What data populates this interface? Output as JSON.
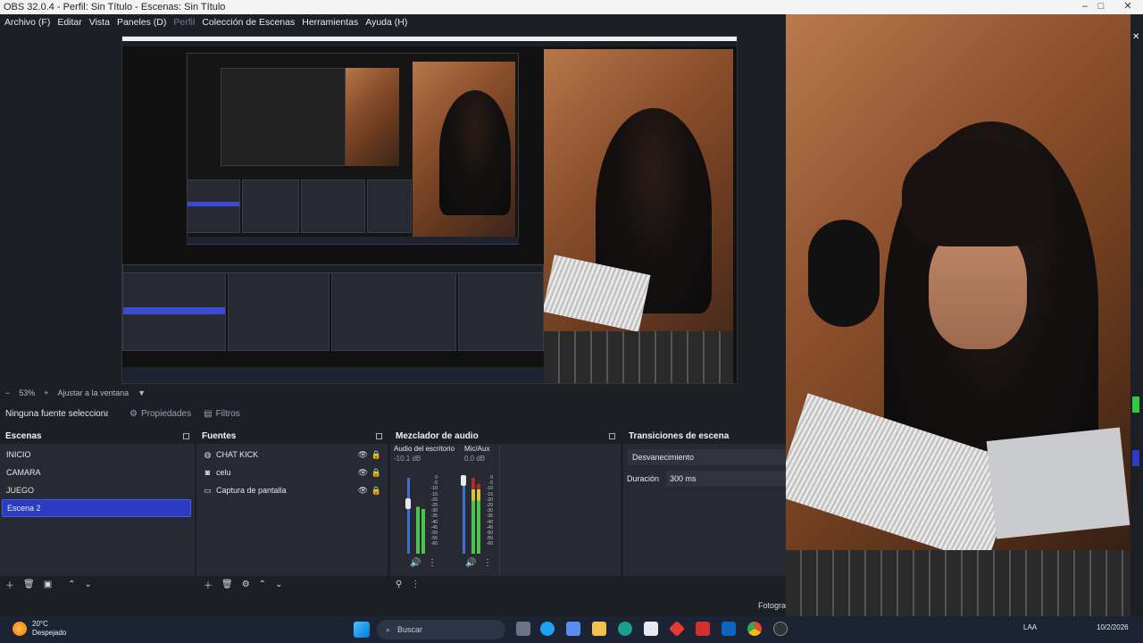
{
  "window": {
    "title": "OBS 32.0.4 - Perfil: Sin Título - Escenas: Sin Título",
    "minimize": "–",
    "maximize": "□",
    "close": "✕"
  },
  "menu": [
    "Archivo (F)",
    "Editar",
    "Vista",
    "Paneles (D)",
    "Perfil",
    "Colección de Escenas",
    "Herramientas",
    "Ayuda (H)"
  ],
  "zoom": {
    "value": "53%",
    "fit": "Ajustar a la ventana"
  },
  "source_toolbar": {
    "none_selected": "Ninguna fuente seleccionada",
    "properties": "Propiedades",
    "filters": "Filtros"
  },
  "scenes": {
    "title": "Escenas",
    "items": [
      "INICIO",
      "CAMARA",
      "JUEGO",
      "Escena 2"
    ],
    "selected_index": 3
  },
  "sources": {
    "title": "Fuentes",
    "items": [
      {
        "label": "CHAT KICK",
        "icon": "globe-icon"
      },
      {
        "label": "celu",
        "icon": "camera-icon"
      },
      {
        "label": "Captura de pantalla",
        "icon": "monitor-icon"
      }
    ]
  },
  "mixer": {
    "title": "Mezclador de audio",
    "channels": [
      {
        "name": "Audio del escritorio",
        "db": "-10.1 dB",
        "level": 0.62
      },
      {
        "name": "Mic/Aux",
        "db": "0.0 dB",
        "level": 1.0
      }
    ],
    "ticks": [
      "0",
      "-5",
      "-10",
      "-15",
      "-20",
      "-25",
      "-30",
      "-35",
      "-40",
      "-45",
      "-50",
      "-55",
      "-60"
    ]
  },
  "transitions": {
    "title": "Transiciones de escena",
    "selected": "Desvanecimiento",
    "duration_label": "Duración",
    "duration_value": "300 ms"
  },
  "status": {
    "fps_label": "Fotogra"
  },
  "taskbar": {
    "temp": "20°C",
    "weather": "Despejado",
    "search_placeholder": "Buscar",
    "lang": "LAA",
    "date": "10/2/2026"
  },
  "colors": {
    "accent": "#2b3cc2",
    "panel": "#272a33",
    "background": "#1d1f26",
    "taskbar": "#1c2333"
  }
}
